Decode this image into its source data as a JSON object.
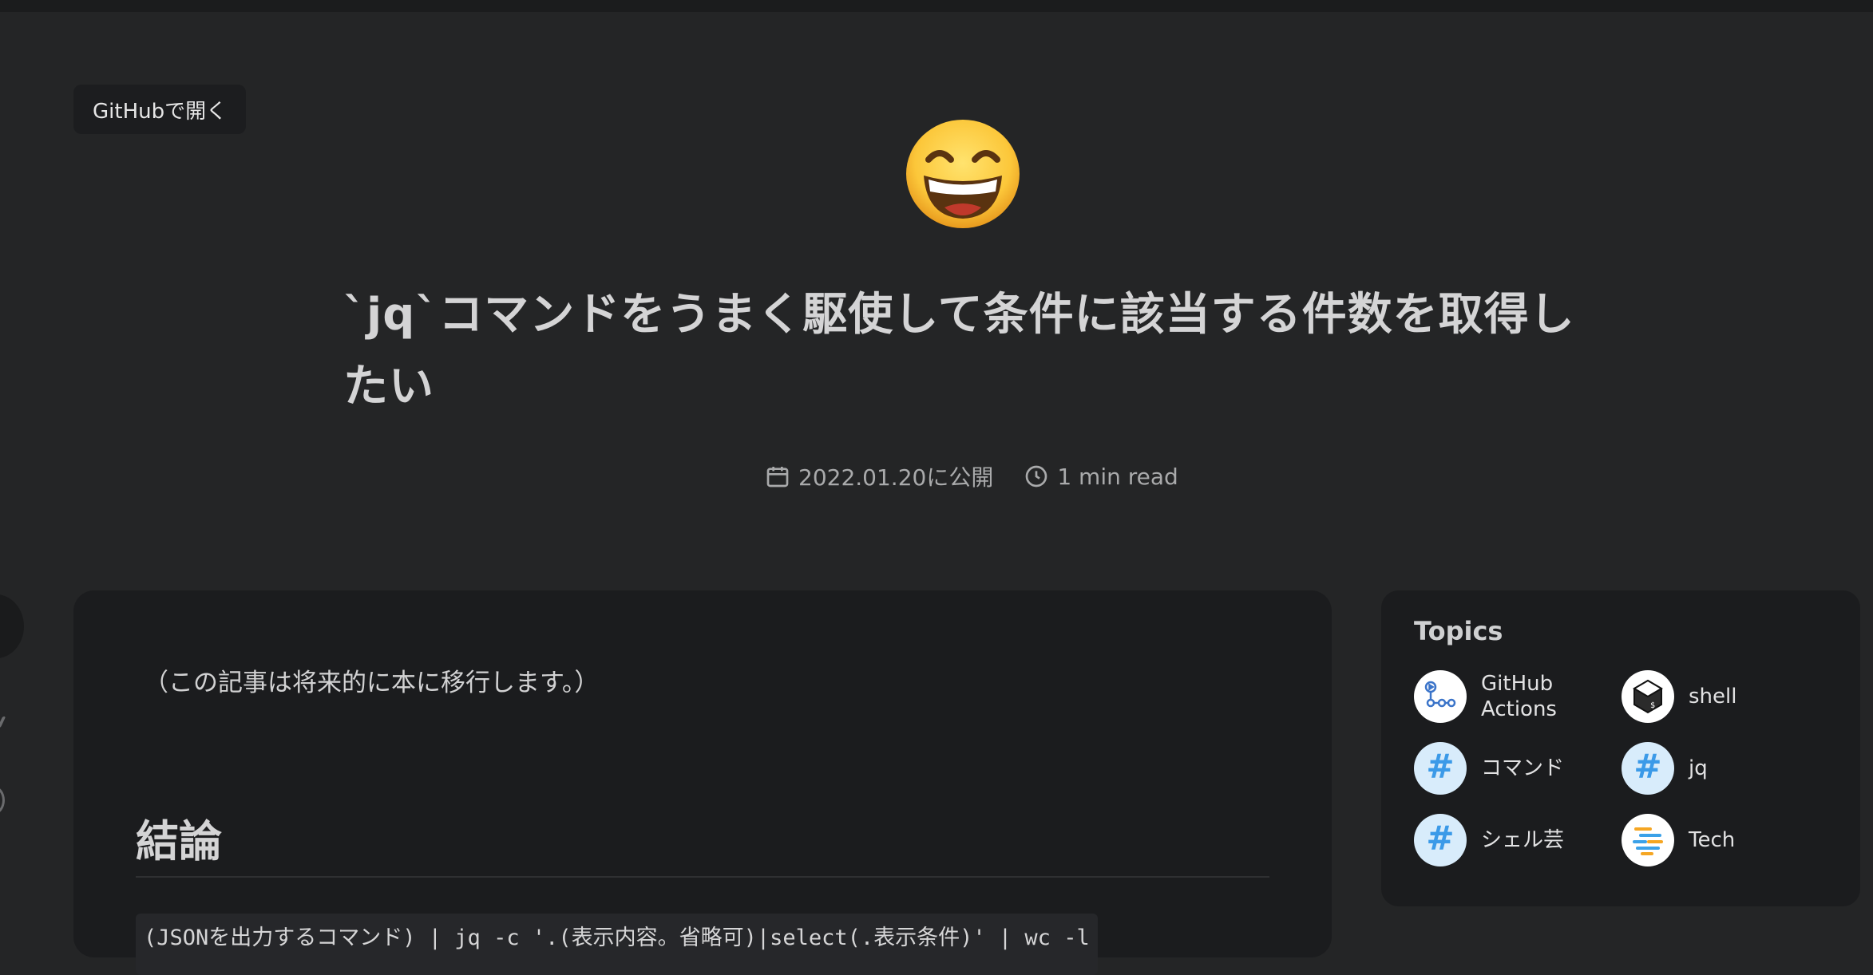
{
  "header": {
    "github_button_label": "GitHubで開く"
  },
  "article": {
    "emoji_icon": "grinning-face-with-smiling-eyes",
    "title": "`jq`コマンドをうまく駆使して条件に該当する件数を取得したい",
    "published": "2022.01.20に公開",
    "read_time": "1 min read",
    "note": "（この記事は将来的に本に移行します。）",
    "section_heading": "結論",
    "code": "(JSONを出力するコマンド) | jq -c '.(表示内容。省略可)|select(.表示条件)' | wc -l"
  },
  "topics": {
    "heading": "Topics",
    "items": [
      {
        "label": "GitHub Actions",
        "icon": "github-actions-icon"
      },
      {
        "label": "shell",
        "icon": "shell-icon"
      },
      {
        "label": "コマンド",
        "icon": "hash-icon"
      },
      {
        "label": "jq",
        "icon": "hash-icon"
      },
      {
        "label": "シェル芸",
        "icon": "hash-icon"
      },
      {
        "label": "Tech",
        "icon": "tech-icon"
      }
    ]
  },
  "colors": {
    "background": "#242526",
    "card": "#1b1c1e",
    "hash_icon_bg": "#d8ecfb",
    "hash_icon_fg": "#3b9ae8"
  }
}
